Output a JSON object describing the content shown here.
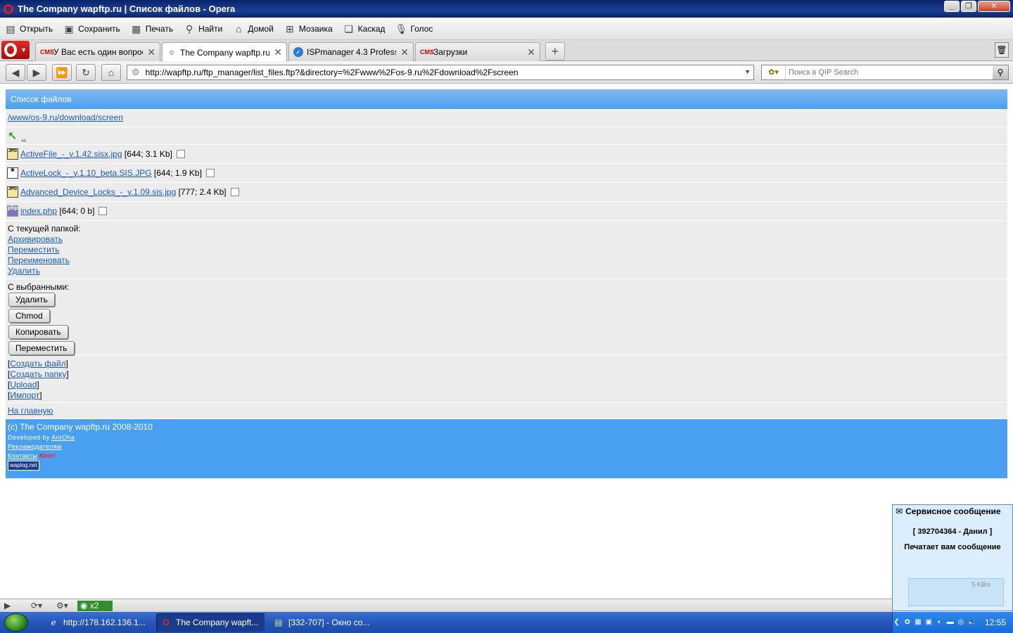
{
  "window": {
    "title": "The Company wapftp.ru | Список файлов - Opera"
  },
  "toolbar": {
    "items": [
      {
        "label": "Открыть",
        "icon": "open-folder-icon"
      },
      {
        "label": "Сохранить",
        "icon": "save-icon"
      },
      {
        "label": "Печать",
        "icon": "print-icon"
      },
      {
        "label": "Найти",
        "icon": "find-icon"
      },
      {
        "label": "Домой",
        "icon": "home-icon"
      },
      {
        "label": "Мозаика",
        "icon": "tile-icon"
      },
      {
        "label": "Каскад",
        "icon": "cascade-icon"
      },
      {
        "label": "Голос",
        "icon": "voice-icon"
      }
    ]
  },
  "tabs": [
    {
      "label": "У Вас есть один вопрос...",
      "icon": "cms-icon"
    },
    {
      "label": "The Company wapftp.ru...",
      "icon": "gear-icon"
    },
    {
      "label": "ISPmanager 4.3 Professi...",
      "icon": "ispmanager-icon"
    },
    {
      "label": "Загрузки",
      "icon": "cms-icon"
    }
  ],
  "address": {
    "url": "http://wapftp.ru/ftp_manager/list_files.ftp?&directory=%2Fwww%2Fos-9.ru%2Fdownload%2Fscreen",
    "search_placeholder": "Поиск в QIP Search"
  },
  "page": {
    "header": "Список файлов",
    "path": "/www/os-9.ru/download/screen",
    "up": "..",
    "files": [
      {
        "name": "ActiveFile_-_v.1.42.sisx.jpg",
        "meta": "[644; 3.1 Kb]",
        "type": "jpg"
      },
      {
        "name": "ActiveLock_-_v.1.10_beta.SIS.JPG",
        "meta": "[644; 1.9 Kb]",
        "type": "img"
      },
      {
        "name": "Advanced_Device_Locks_-_v.1.09.sis.jpg",
        "meta": "[777; 2.4 Kb]",
        "type": "jpg"
      },
      {
        "name": "index.php",
        "meta": "[644; 0 b]",
        "type": "php"
      }
    ],
    "folder_actions_label": "С текущей папкой:",
    "folder_actions": [
      "Архивировать",
      "Переместить",
      "Переименовать",
      "Удалить"
    ],
    "selected_label": "С выбранными:",
    "selected_buttons": [
      "Удалить",
      "Chmod",
      "Копировать",
      "Переместить"
    ],
    "create_links": [
      "Создать файл",
      "Создать папку",
      "Upload",
      "Импорт"
    ],
    "home_link": "На главную",
    "footer": {
      "copyright": "(c) The Company wapftp.ru 2008-2010",
      "developed_prefix": "Developed by",
      "developer": "AntOha",
      "ads": "Рекламодателям",
      "contacts": "Контакты",
      "new_badge": "New!",
      "badge": "waplog.net"
    }
  },
  "popup": {
    "title": "Сервисное сообщение",
    "contact": "[ 392704364 - Данил ]",
    "message": "Печатает вам сообщение",
    "speed": "5 KB/s"
  },
  "statusbar": {
    "badge": "x2"
  },
  "taskbar": {
    "tasks": [
      {
        "label": "http://178.162.136.1...",
        "icon": "ie-icon"
      },
      {
        "label": "The Company wapft...",
        "icon": "opera-icon"
      },
      {
        "label": "[332-707] - Окно со...",
        "icon": "chat-window-icon"
      }
    ],
    "clock": "12:55"
  }
}
